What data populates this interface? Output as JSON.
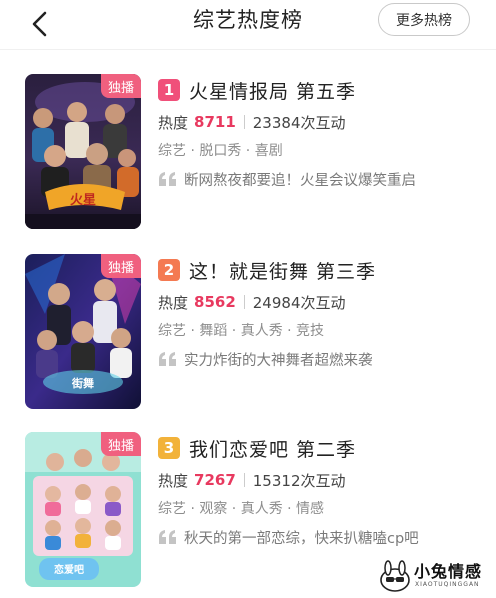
{
  "header": {
    "title": "综艺热度榜",
    "more_label": "更多热榜"
  },
  "items": [
    {
      "badge": "独播",
      "rank": "1",
      "rank_color": "#f0507a",
      "name": "火星情报局 第五季",
      "heat_label": "热度",
      "heat_value": "8711",
      "interactions": "23384次互动",
      "tags": "综艺 · 脱口秀 · 喜剧",
      "quote": "断网熬夜都要追！火星会议爆笑重启"
    },
    {
      "badge": "独播",
      "rank": "2",
      "rank_color": "#f47a52",
      "name": "这！就是街舞 第三季",
      "heat_label": "热度",
      "heat_value": "8562",
      "interactions": "24984次互动",
      "tags": "综艺 · 舞蹈 · 真人秀 · 竞技",
      "quote": "实力炸街的大神舞者超燃来袭"
    },
    {
      "badge": "独播",
      "rank": "3",
      "rank_color": "#f2b23a",
      "name": "我们恋爱吧 第二季",
      "heat_label": "热度",
      "heat_value": "7267",
      "interactions": "15312次互动",
      "tags": "综艺 · 观察 · 真人秀 · 情感",
      "quote": "秋天的第一部恋综，快来扒糖嗑cp吧"
    }
  ],
  "watermark": {
    "text": "小兔情感",
    "sub": "XIAOTUQINGGAN"
  },
  "icons": {
    "back": "back-arrow-icon",
    "quote": "quote-icon"
  }
}
